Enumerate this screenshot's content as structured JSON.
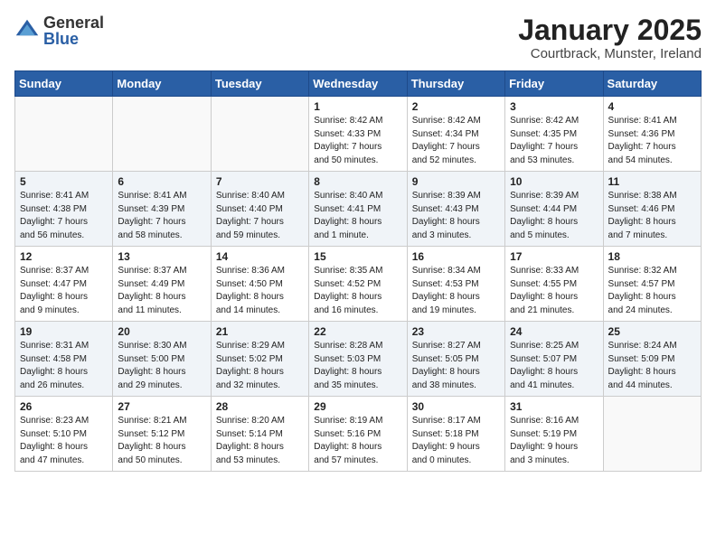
{
  "header": {
    "logo_general": "General",
    "logo_blue": "Blue",
    "title": "January 2025",
    "subtitle": "Courtbrack, Munster, Ireland"
  },
  "days_of_week": [
    "Sunday",
    "Monday",
    "Tuesday",
    "Wednesday",
    "Thursday",
    "Friday",
    "Saturday"
  ],
  "weeks": [
    [
      {
        "day": "",
        "info": ""
      },
      {
        "day": "",
        "info": ""
      },
      {
        "day": "",
        "info": ""
      },
      {
        "day": "1",
        "info": "Sunrise: 8:42 AM\nSunset: 4:33 PM\nDaylight: 7 hours\nand 50 minutes."
      },
      {
        "day": "2",
        "info": "Sunrise: 8:42 AM\nSunset: 4:34 PM\nDaylight: 7 hours\nand 52 minutes."
      },
      {
        "day": "3",
        "info": "Sunrise: 8:42 AM\nSunset: 4:35 PM\nDaylight: 7 hours\nand 53 minutes."
      },
      {
        "day": "4",
        "info": "Sunrise: 8:41 AM\nSunset: 4:36 PM\nDaylight: 7 hours\nand 54 minutes."
      }
    ],
    [
      {
        "day": "5",
        "info": "Sunrise: 8:41 AM\nSunset: 4:38 PM\nDaylight: 7 hours\nand 56 minutes."
      },
      {
        "day": "6",
        "info": "Sunrise: 8:41 AM\nSunset: 4:39 PM\nDaylight: 7 hours\nand 58 minutes."
      },
      {
        "day": "7",
        "info": "Sunrise: 8:40 AM\nSunset: 4:40 PM\nDaylight: 7 hours\nand 59 minutes."
      },
      {
        "day": "8",
        "info": "Sunrise: 8:40 AM\nSunset: 4:41 PM\nDaylight: 8 hours\nand 1 minute."
      },
      {
        "day": "9",
        "info": "Sunrise: 8:39 AM\nSunset: 4:43 PM\nDaylight: 8 hours\nand 3 minutes."
      },
      {
        "day": "10",
        "info": "Sunrise: 8:39 AM\nSunset: 4:44 PM\nDaylight: 8 hours\nand 5 minutes."
      },
      {
        "day": "11",
        "info": "Sunrise: 8:38 AM\nSunset: 4:46 PM\nDaylight: 8 hours\nand 7 minutes."
      }
    ],
    [
      {
        "day": "12",
        "info": "Sunrise: 8:37 AM\nSunset: 4:47 PM\nDaylight: 8 hours\nand 9 minutes."
      },
      {
        "day": "13",
        "info": "Sunrise: 8:37 AM\nSunset: 4:49 PM\nDaylight: 8 hours\nand 11 minutes."
      },
      {
        "day": "14",
        "info": "Sunrise: 8:36 AM\nSunset: 4:50 PM\nDaylight: 8 hours\nand 14 minutes."
      },
      {
        "day": "15",
        "info": "Sunrise: 8:35 AM\nSunset: 4:52 PM\nDaylight: 8 hours\nand 16 minutes."
      },
      {
        "day": "16",
        "info": "Sunrise: 8:34 AM\nSunset: 4:53 PM\nDaylight: 8 hours\nand 19 minutes."
      },
      {
        "day": "17",
        "info": "Sunrise: 8:33 AM\nSunset: 4:55 PM\nDaylight: 8 hours\nand 21 minutes."
      },
      {
        "day": "18",
        "info": "Sunrise: 8:32 AM\nSunset: 4:57 PM\nDaylight: 8 hours\nand 24 minutes."
      }
    ],
    [
      {
        "day": "19",
        "info": "Sunrise: 8:31 AM\nSunset: 4:58 PM\nDaylight: 8 hours\nand 26 minutes."
      },
      {
        "day": "20",
        "info": "Sunrise: 8:30 AM\nSunset: 5:00 PM\nDaylight: 8 hours\nand 29 minutes."
      },
      {
        "day": "21",
        "info": "Sunrise: 8:29 AM\nSunset: 5:02 PM\nDaylight: 8 hours\nand 32 minutes."
      },
      {
        "day": "22",
        "info": "Sunrise: 8:28 AM\nSunset: 5:03 PM\nDaylight: 8 hours\nand 35 minutes."
      },
      {
        "day": "23",
        "info": "Sunrise: 8:27 AM\nSunset: 5:05 PM\nDaylight: 8 hours\nand 38 minutes."
      },
      {
        "day": "24",
        "info": "Sunrise: 8:25 AM\nSunset: 5:07 PM\nDaylight: 8 hours\nand 41 minutes."
      },
      {
        "day": "25",
        "info": "Sunrise: 8:24 AM\nSunset: 5:09 PM\nDaylight: 8 hours\nand 44 minutes."
      }
    ],
    [
      {
        "day": "26",
        "info": "Sunrise: 8:23 AM\nSunset: 5:10 PM\nDaylight: 8 hours\nand 47 minutes."
      },
      {
        "day": "27",
        "info": "Sunrise: 8:21 AM\nSunset: 5:12 PM\nDaylight: 8 hours\nand 50 minutes."
      },
      {
        "day": "28",
        "info": "Sunrise: 8:20 AM\nSunset: 5:14 PM\nDaylight: 8 hours\nand 53 minutes."
      },
      {
        "day": "29",
        "info": "Sunrise: 8:19 AM\nSunset: 5:16 PM\nDaylight: 8 hours\nand 57 minutes."
      },
      {
        "day": "30",
        "info": "Sunrise: 8:17 AM\nSunset: 5:18 PM\nDaylight: 9 hours\nand 0 minutes."
      },
      {
        "day": "31",
        "info": "Sunrise: 8:16 AM\nSunset: 5:19 PM\nDaylight: 9 hours\nand 3 minutes."
      },
      {
        "day": "",
        "info": ""
      }
    ]
  ]
}
